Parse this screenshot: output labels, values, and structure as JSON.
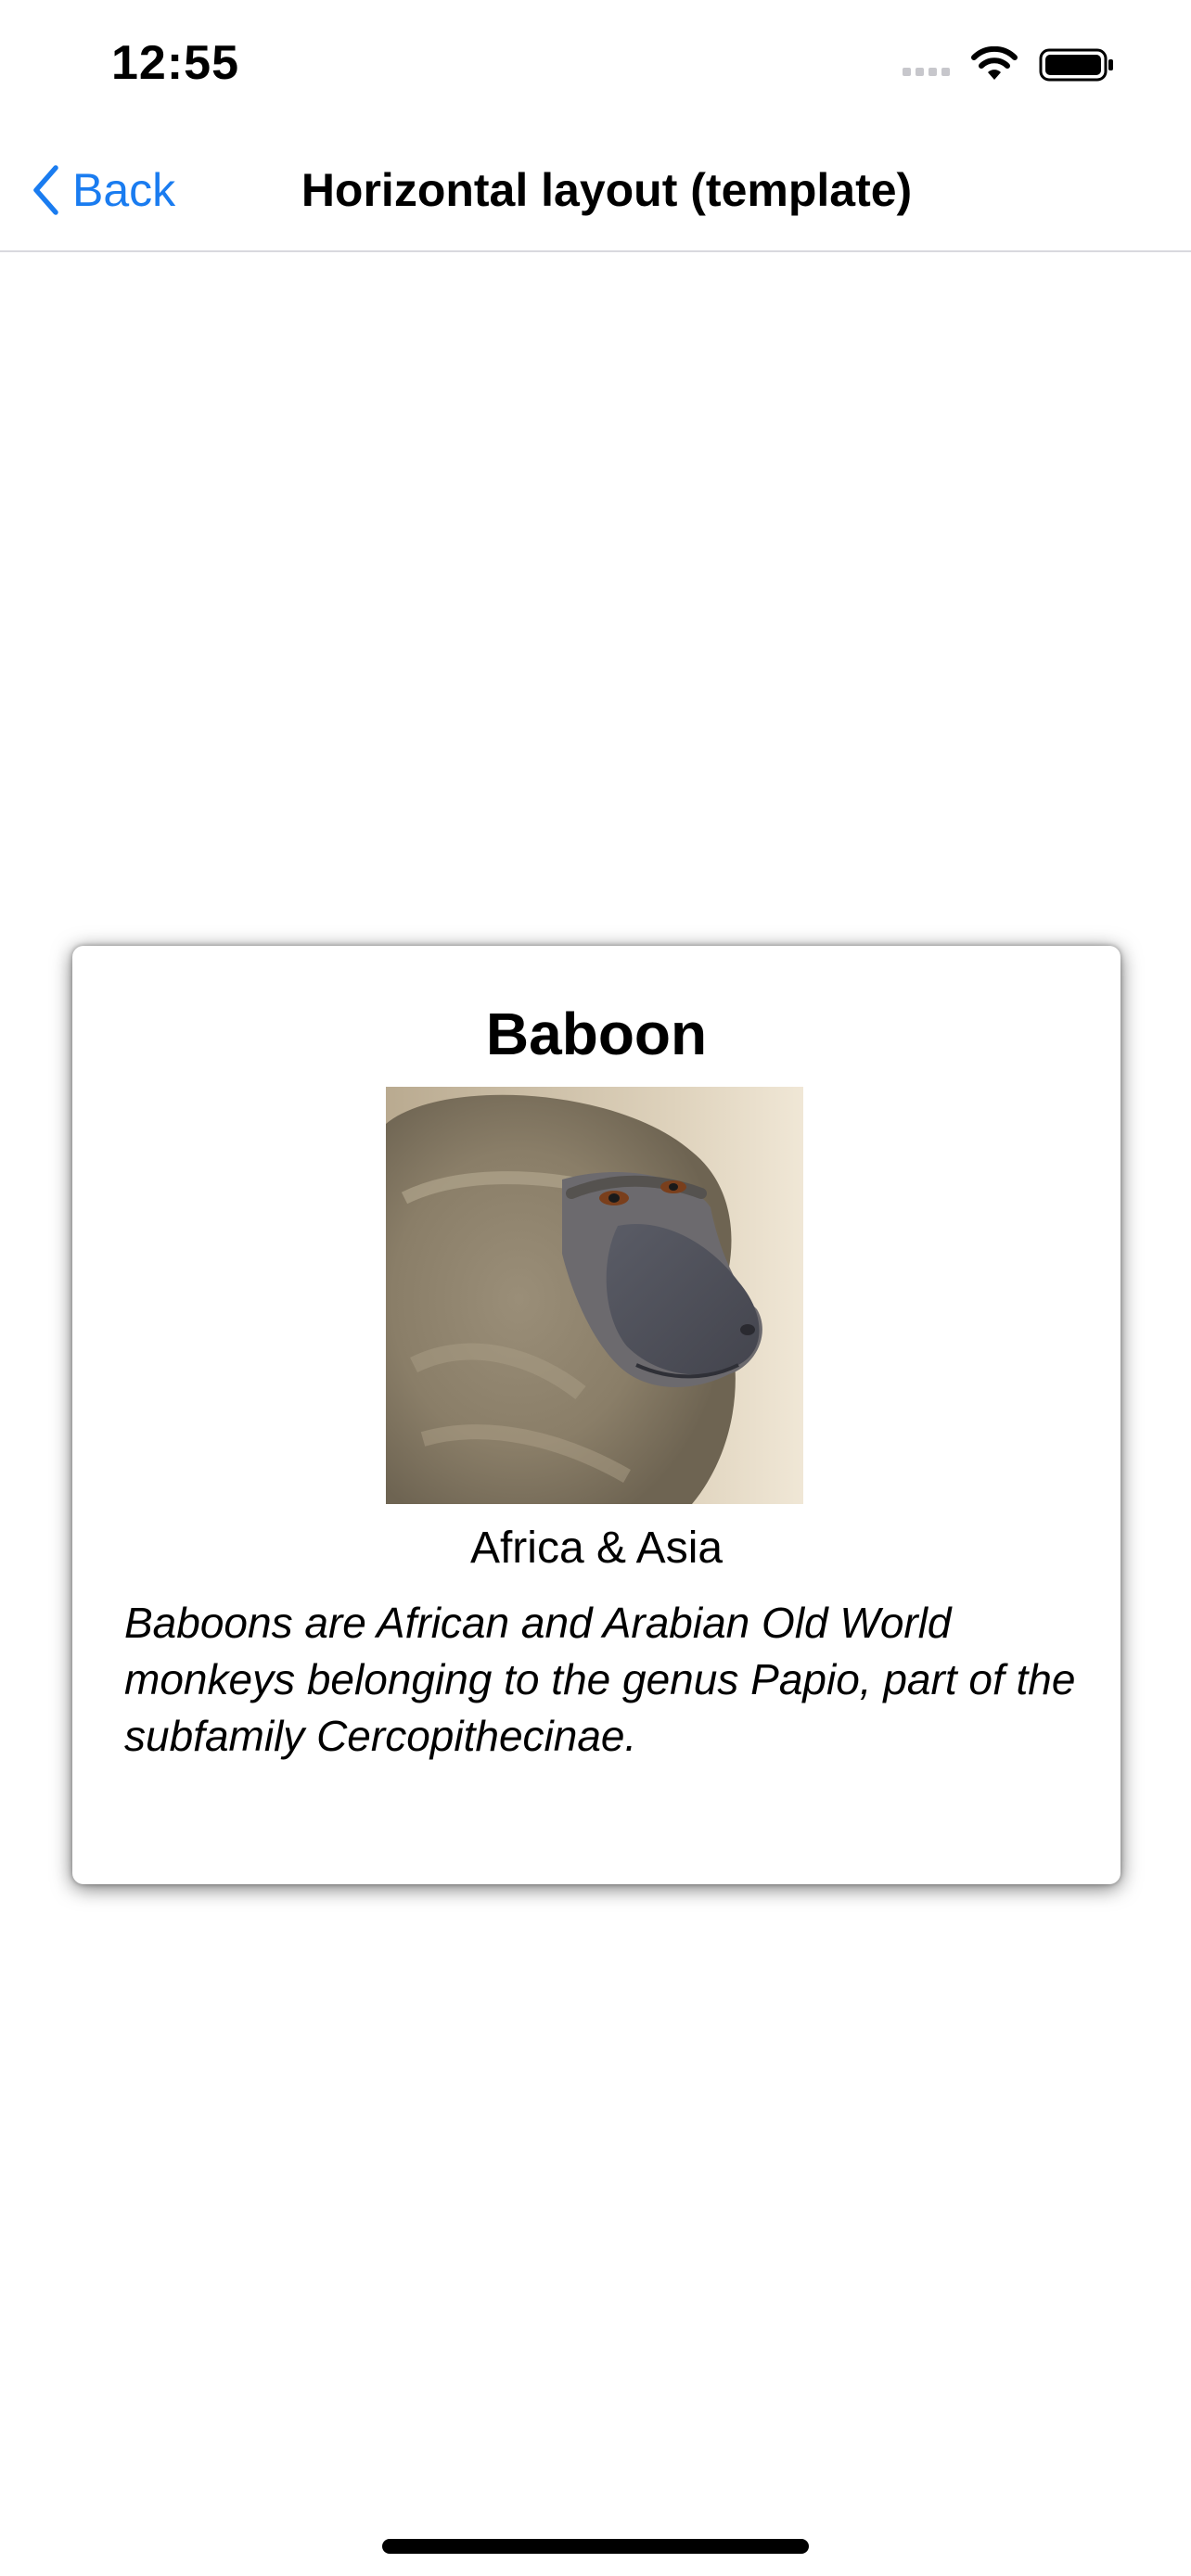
{
  "status_bar": {
    "time": "12:55"
  },
  "nav": {
    "back_label": "Back",
    "title": "Horizontal layout (template)"
  },
  "card": {
    "title": "Baboon",
    "image_subject": "baboon-photo",
    "subtitle": "Africa & Asia",
    "description": "Baboons are African and Arabian Old World monkeys belonging to the genus Papio, part of the subfamily Cercopithecinae."
  },
  "colors": {
    "accent": "#1a7cf0",
    "background": "#ffffff",
    "divider": "#d9d9de"
  }
}
